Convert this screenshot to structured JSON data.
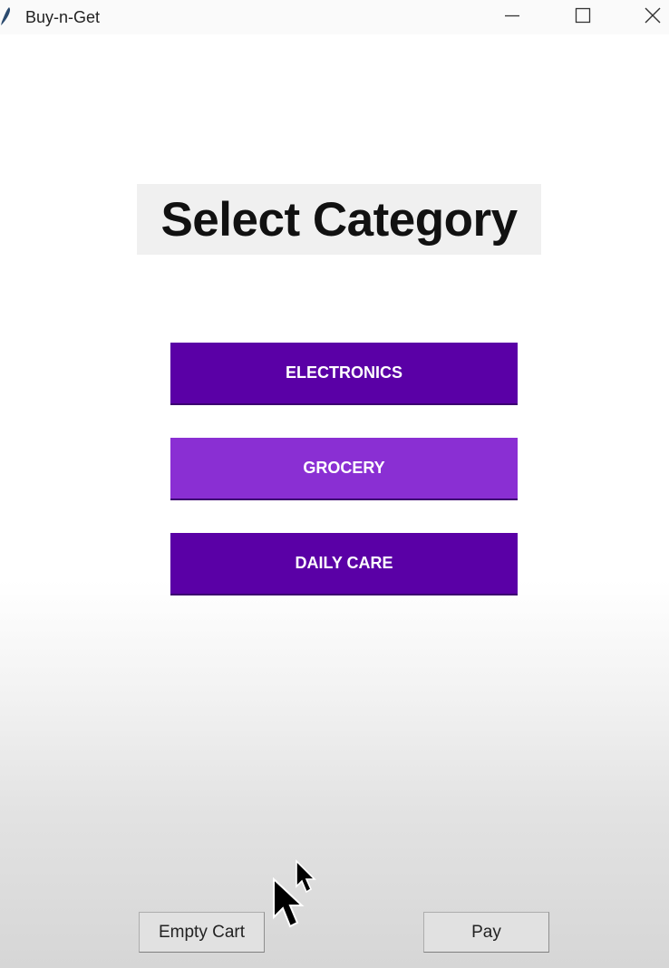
{
  "window": {
    "title": "Buy-n-Get",
    "controls": [
      "minimize",
      "maximize",
      "close"
    ]
  },
  "main": {
    "heading": "Select Category",
    "categories": [
      {
        "label": "ELECTRONICS",
        "color": "#5a00a6"
      },
      {
        "label": "GROCERY",
        "color": "#8a2fd3"
      },
      {
        "label": "DAILY CARE",
        "color": "#5a00a6"
      }
    ]
  },
  "footer": {
    "empty_cart_label": "Empty Cart",
    "pay_label": "Pay"
  },
  "icons": {
    "app": "feather-icon",
    "minimize": "minimize-icon",
    "maximize": "maximize-icon",
    "close": "close-icon",
    "cursor": "mouse-pointer-icon"
  }
}
